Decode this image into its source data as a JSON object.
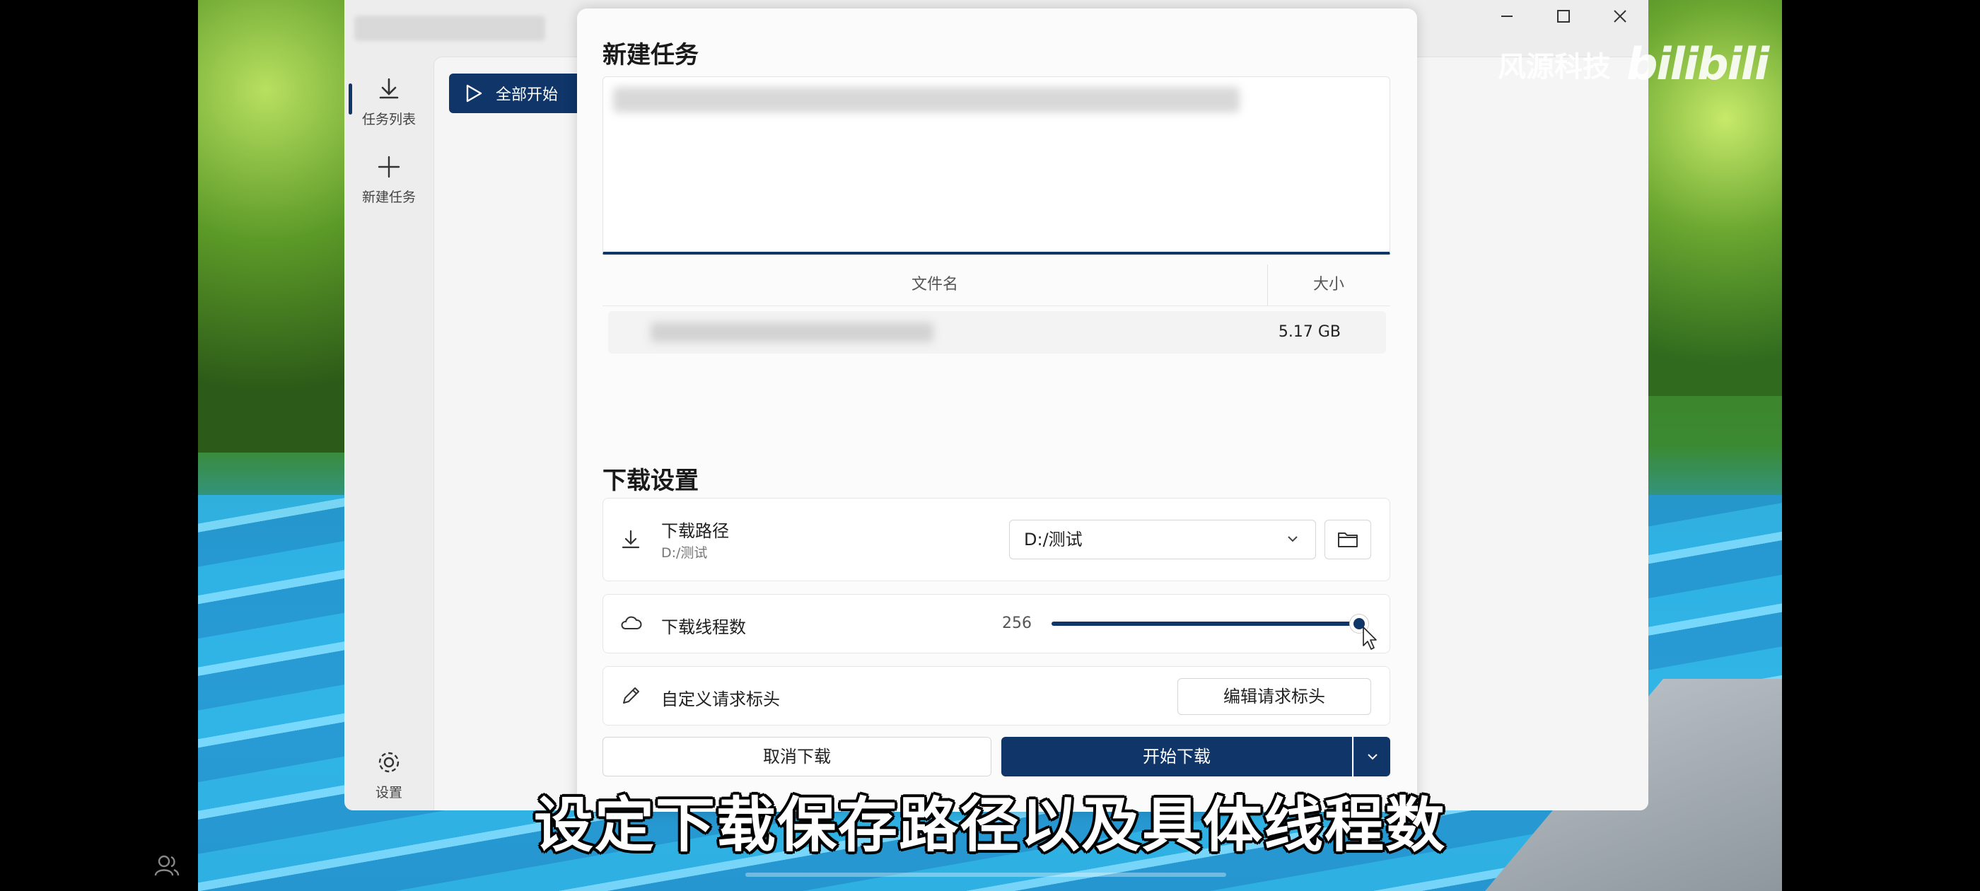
{
  "sidebar": {
    "items": [
      {
        "label": "任务列表",
        "icon": "download-icon",
        "active": true
      },
      {
        "label": "新建任务",
        "icon": "plus-icon",
        "active": false
      }
    ],
    "settings_label": "设置"
  },
  "toolbar": {
    "start_all_label": "全部开始"
  },
  "window_controls": [
    "minimize-icon",
    "maximize-icon",
    "close-icon"
  ],
  "dialog": {
    "title": "新建任务",
    "file_table": {
      "columns": [
        "文件名",
        "大小"
      ],
      "rows": [
        {
          "size": "5.17 GB"
        }
      ]
    },
    "settings": {
      "title": "下载设置",
      "path": {
        "label": "下载路径",
        "current": "D:/测试",
        "selected": "D:/测试"
      },
      "threads": {
        "label": "下载线程数",
        "value": "256",
        "fraction": 1.0
      },
      "headers": {
        "label": "自定义请求标头",
        "button": "编辑请求标头"
      }
    },
    "cancel_label": "取消下载",
    "start_label": "开始下载"
  },
  "overlay": {
    "watermark_text": "风源科技",
    "watermark_logo": "bilibili",
    "subtitle": "设定下载保存路径以及具体线程数"
  },
  "colors": {
    "accent": "#0f3569"
  }
}
